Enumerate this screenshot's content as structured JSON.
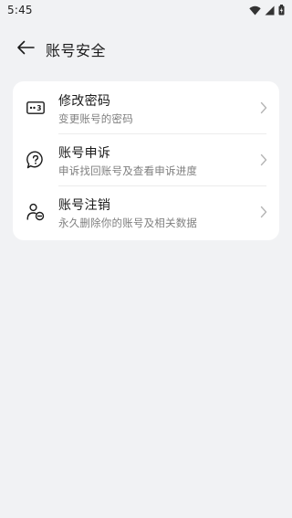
{
  "status_bar": {
    "time": "5:45",
    "icons": [
      "wifi-icon",
      "signal-icon",
      "battery-icon"
    ]
  },
  "header": {
    "back_icon": "back-arrow-icon",
    "title": "账号安全"
  },
  "settings": {
    "items": [
      {
        "icon": "password-icon",
        "title": "修改密码",
        "subtitle": "变更账号的密码"
      },
      {
        "icon": "help-bubble-icon",
        "title": "账号申诉",
        "subtitle": "申诉找回账号及查看申诉进度"
      },
      {
        "icon": "user-remove-icon",
        "title": "账号注销",
        "subtitle": "永久删除你的账号及相关数据"
      }
    ]
  },
  "colors": {
    "background": "#f1f2f4",
    "card": "#ffffff",
    "title_text": "#1a1a1a",
    "subtitle_text": "#808080",
    "chevron": "#b5b5b5"
  }
}
